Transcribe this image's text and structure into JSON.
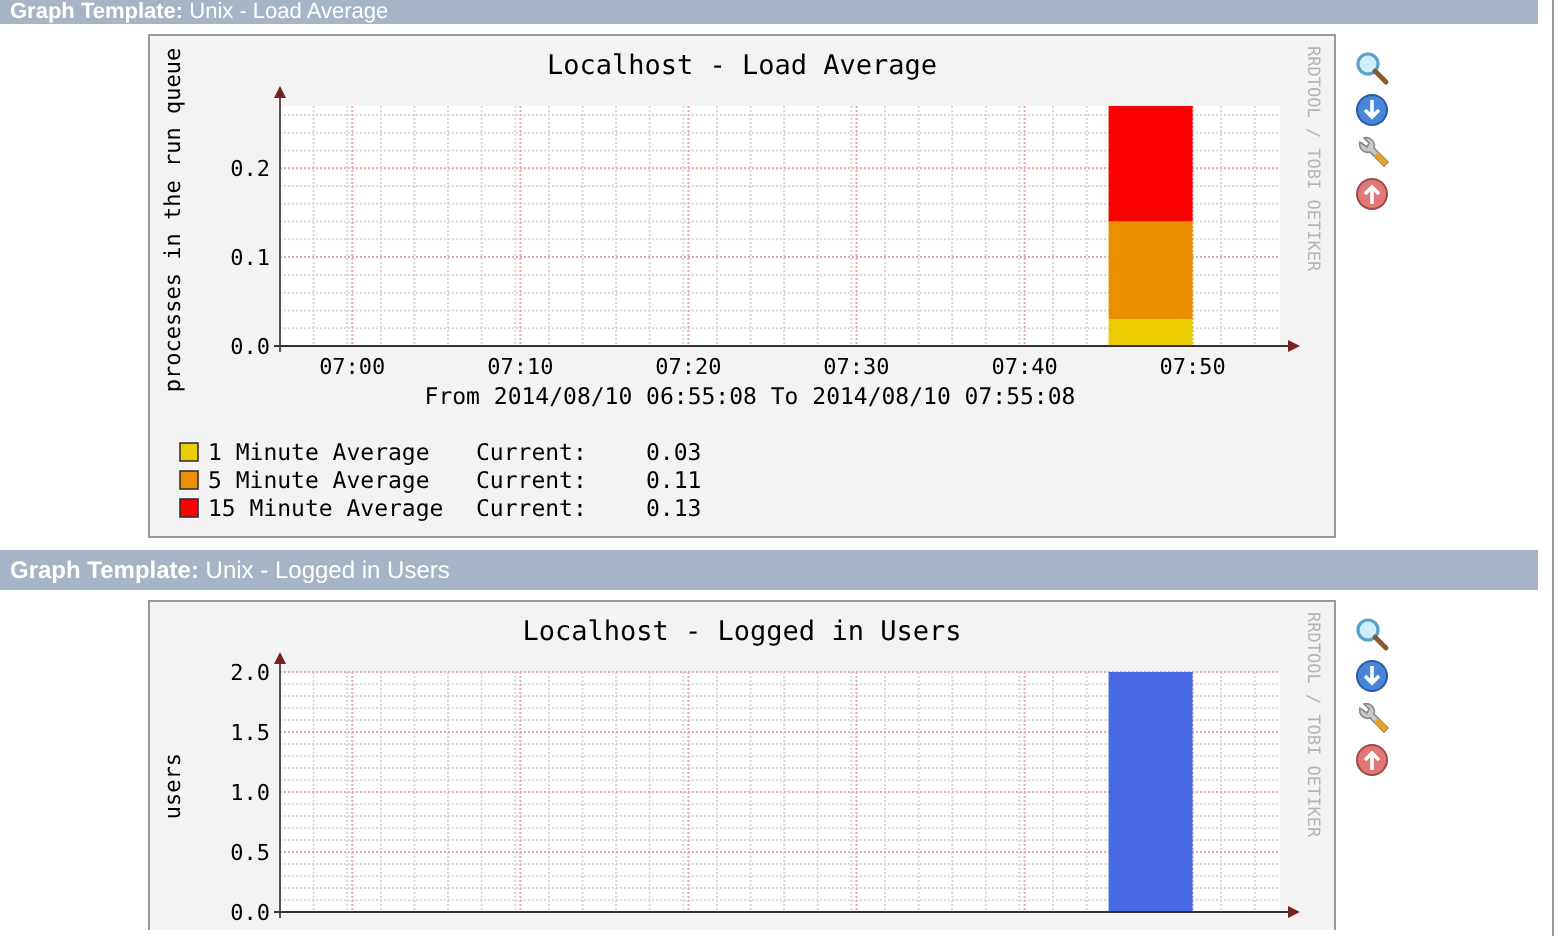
{
  "sections": [
    {
      "header": "**Graph Template:** Unix - Load Average",
      "graph": {
        "title": "Localhost - Load Average",
        "credit": "RRDTOOL / TOBI OETIKER",
        "period": "From 2014/08/10 06:55:08 To 2014/08/10 07:55:08",
        "legend": [
          {
            "label": "Current:",
            "value": "0.03"
          },
          {
            "label": "Current:",
            "value": "0.11"
          },
          {
            "label": "Current:",
            "value": "0.13"
          }
        ],
        "chart_data": {
          "type": "area",
          "stacked": true,
          "grid": true,
          "legend": "bottom",
          "ylabel": "processes in the run queue",
          "categories": [
            null,
            "07:00",
            null,
            "07:10",
            null,
            "07:20",
            null,
            "07:30",
            null,
            "07:40",
            null,
            "07:50",
            null
          ],
          "ylim": [
            0,
            0.27
          ],
          "yticks": [
            {
              "value": 0,
              "label": "0.0"
            },
            {
              "value": 0.1,
              "label": "0.1"
            },
            {
              "value": 0.2,
              "label": "0.2"
            }
          ],
          "series": [
            {
              "name": "1 Minute Average",
              "color": "#eacc00",
              "values": [
                null,
                null,
                null,
                null,
                null,
                null,
                null,
                null,
                null,
                null,
                0.03,
                0.03,
                null
              ]
            },
            {
              "name": "5 Minute Average",
              "color": "#ea8f00",
              "values": [
                null,
                null,
                null,
                null,
                null,
                null,
                null,
                null,
                null,
                null,
                0.11,
                0.11,
                null
              ]
            },
            {
              "name": "15 Minute Average",
              "color": "#ff0000",
              "values": [
                null,
                null,
                null,
                null,
                null,
                null,
                null,
                null,
                null,
                null,
                0.13,
                0.13,
                null
              ]
            }
          ]
        }
      }
    },
    {
      "header": "**Graph Template:** Unix - Logged in Users",
      "graph": {
        "title": "Localhost - Logged in Users",
        "credit": "RRDTOOL / TOBI OETIKER",
        "chart_data": {
          "type": "area",
          "grid": true,
          "ylabel": "users",
          "categories": [
            null,
            null,
            null,
            null,
            null,
            null,
            null,
            null,
            null,
            null,
            null,
            null,
            null
          ],
          "ylim": [
            0,
            2.0
          ],
          "yticks": [
            {
              "value": 0,
              "label": "0.0"
            },
            {
              "value": 0.5,
              "label": "0.5"
            },
            {
              "value": 1,
              "label": "1.0"
            },
            {
              "value": 1.5,
              "label": "1.5"
            },
            {
              "value": 2,
              "label": "2.0"
            }
          ],
          "series": [
            {
              "color": "#4668e4",
              "values": [
                null,
                null,
                null,
                null,
                null,
                null,
                null,
                null,
                null,
                null,
                2,
                2,
                null
              ]
            }
          ]
        }
      }
    }
  ]
}
